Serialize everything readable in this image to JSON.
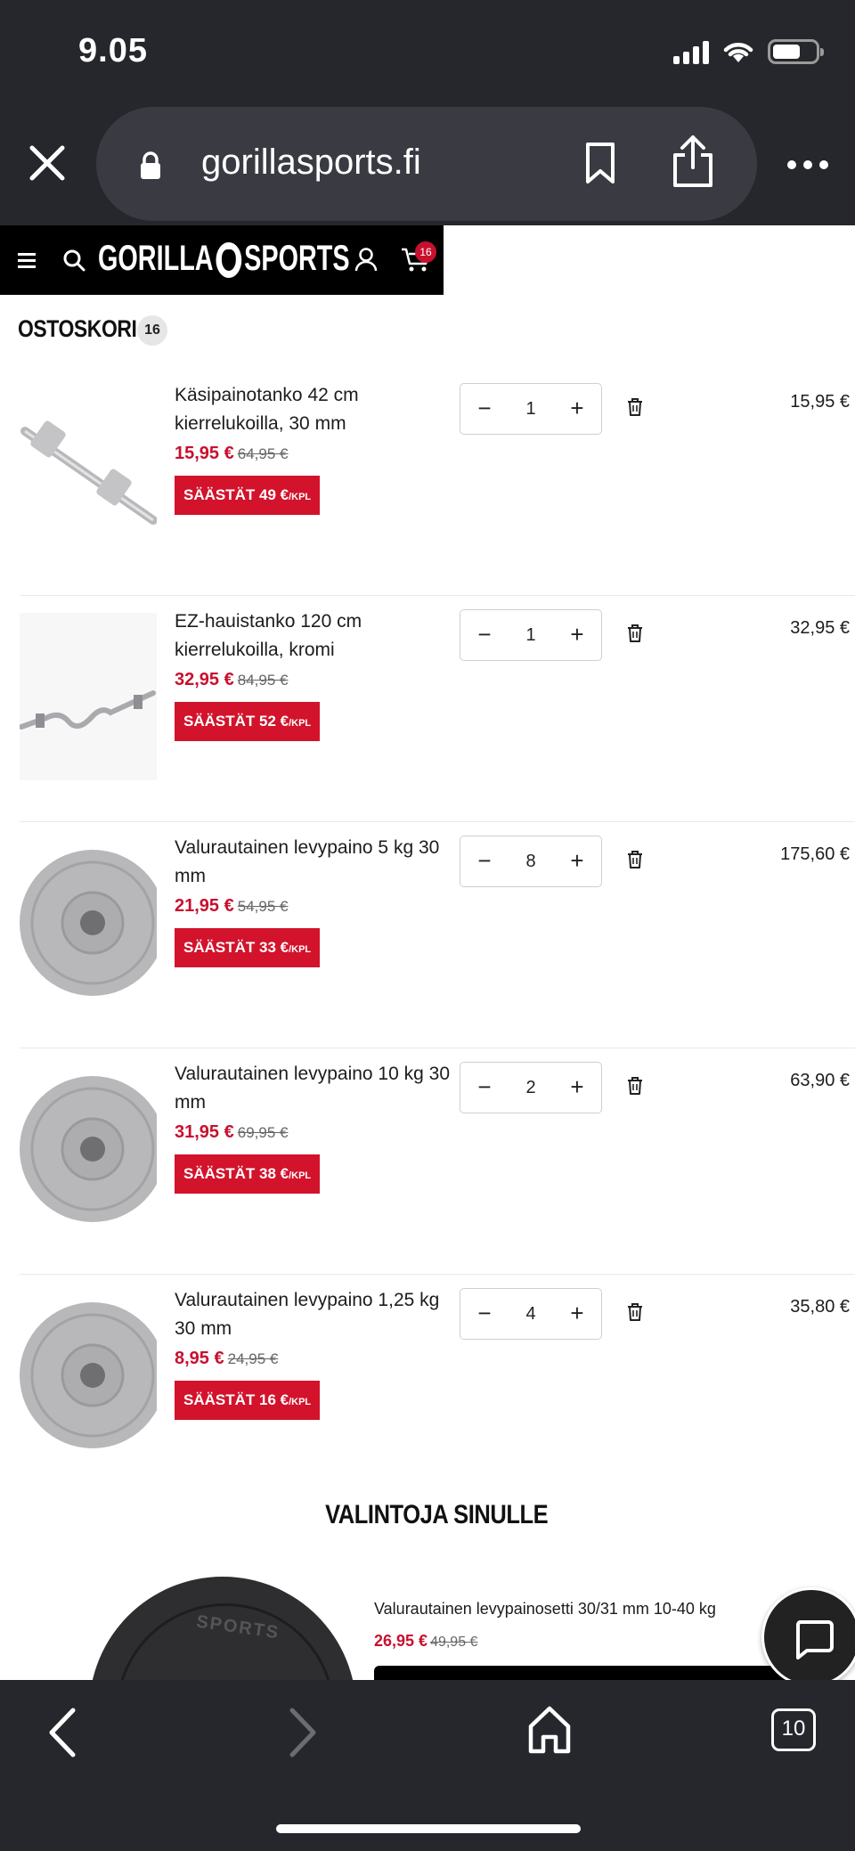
{
  "status_bar": {
    "time": "9.05",
    "battery_level": 0.7
  },
  "browser": {
    "url": "gorillasports.fi",
    "tab_count": "10"
  },
  "site": {
    "logo": "GORILLA SPORTS",
    "cart_badge": "16",
    "accent_color": "#c8102e"
  },
  "cart": {
    "title": "OSTOSKORI",
    "count": "16",
    "items": [
      {
        "name": "Käsipainotanko 42 cm kierrelukoilla, 30 mm",
        "price": "15,95 €",
        "old_price": "64,95 €",
        "save_label": "SÄÄSTÄT 49 €",
        "save_unit": "/KPL",
        "qty": "1",
        "total": "15,95 €",
        "image": "dumbbell-bar"
      },
      {
        "name": "EZ-hauistanko 120 cm kierrelukoilla, kromi",
        "price": "32,95 €",
        "old_price": "84,95 €",
        "save_label": "SÄÄSTÄT 52 €",
        "save_unit": "/KPL",
        "qty": "1",
        "total": "32,95 €",
        "image": "ez-curl-bar"
      },
      {
        "name": "Valurautainen levypaino 5 kg 30 mm",
        "price": "21,95 €",
        "old_price": "54,95 €",
        "save_label": "SÄÄSTÄT 33 €",
        "save_unit": "/KPL",
        "qty": "8",
        "total": "175,60 €",
        "image": "weight-plate"
      },
      {
        "name": "Valurautainen levypaino 10 kg 30 mm",
        "price": "31,95 €",
        "old_price": "69,95 €",
        "save_label": "SÄÄSTÄT 38 €",
        "save_unit": "/KPL",
        "qty": "2",
        "total": "63,90 €",
        "image": "weight-plate"
      },
      {
        "name": "Valurautainen levypaino 1,25 kg 30 mm",
        "price": "8,95 €",
        "old_price": "24,95 €",
        "save_label": "SÄÄSTÄT 16 €",
        "save_unit": "/KPL",
        "qty": "4",
        "total": "35,80 €",
        "image": "weight-plate"
      }
    ],
    "qty_minus": "−",
    "qty_plus": "+"
  },
  "recommendations": {
    "title": "VALINTOJA SINULLE",
    "item": {
      "name": "Valurautainen levypainosetti 30/31 mm 10-40 kg",
      "price": "26,95 €",
      "old_price": "49,95 €",
      "plate_text": "SPORTS"
    }
  }
}
